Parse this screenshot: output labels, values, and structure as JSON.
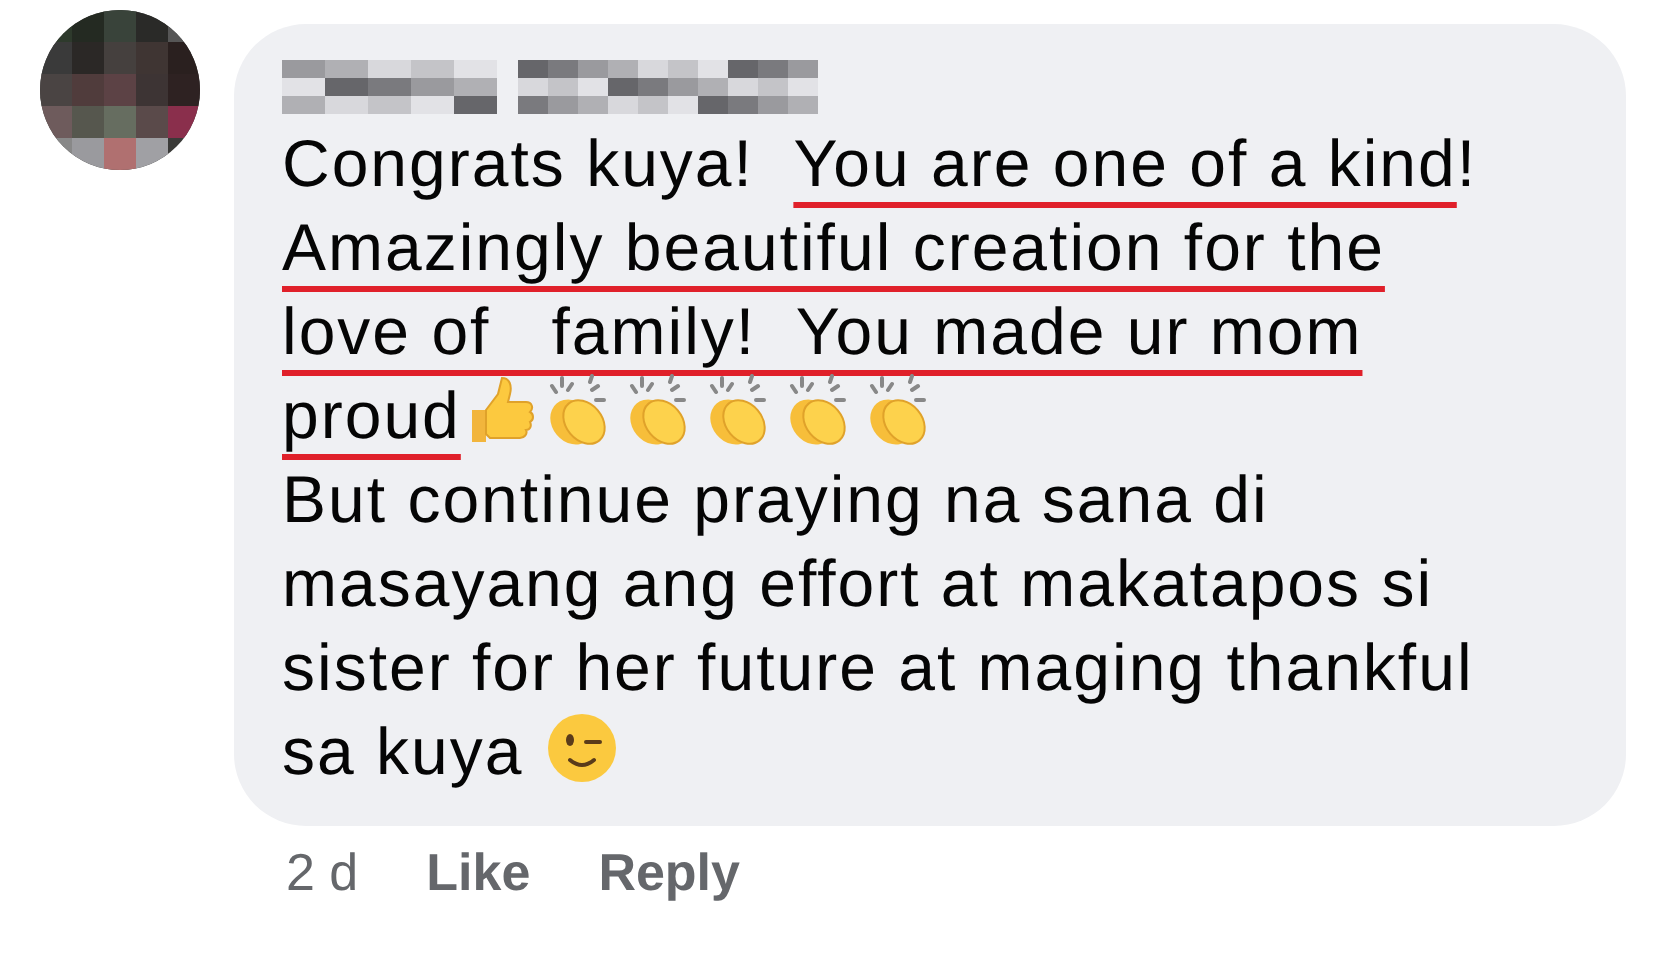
{
  "comment": {
    "author_redacted": true,
    "lines": [
      [
        {
          "kind": "text",
          "text": "Congrats kuya!  ",
          "underlined": false
        },
        {
          "kind": "text",
          "text": "You are one of a kind",
          "underlined": true
        },
        {
          "kind": "text",
          "text": "!",
          "underlined": false
        }
      ],
      [
        {
          "kind": "text",
          "text": "Amazingly beautiful creation for the",
          "underlined": true
        }
      ],
      [
        {
          "kind": "text",
          "text": "love of   family!  You made ur mom",
          "underlined": true
        }
      ],
      [
        {
          "kind": "text",
          "text": "proud",
          "underlined": true
        },
        {
          "kind": "thumbs_up"
        },
        {
          "kind": "clap"
        },
        {
          "kind": "clap"
        },
        {
          "kind": "clap"
        },
        {
          "kind": "clap"
        },
        {
          "kind": "clap"
        }
      ],
      [
        {
          "kind": "text",
          "text": "But continue praying na sana di",
          "underlined": false
        }
      ],
      [
        {
          "kind": "text",
          "text": "masayang ang effort at makatapos si",
          "underlined": false
        }
      ],
      [
        {
          "kind": "text",
          "text": "sister for her future at maging thankful",
          "underlined": false
        }
      ],
      [
        {
          "kind": "text",
          "text": "sa kuya ",
          "underlined": false
        },
        {
          "kind": "wink"
        }
      ]
    ],
    "time": "2 d",
    "actions": [
      "Like",
      "Reply"
    ]
  }
}
